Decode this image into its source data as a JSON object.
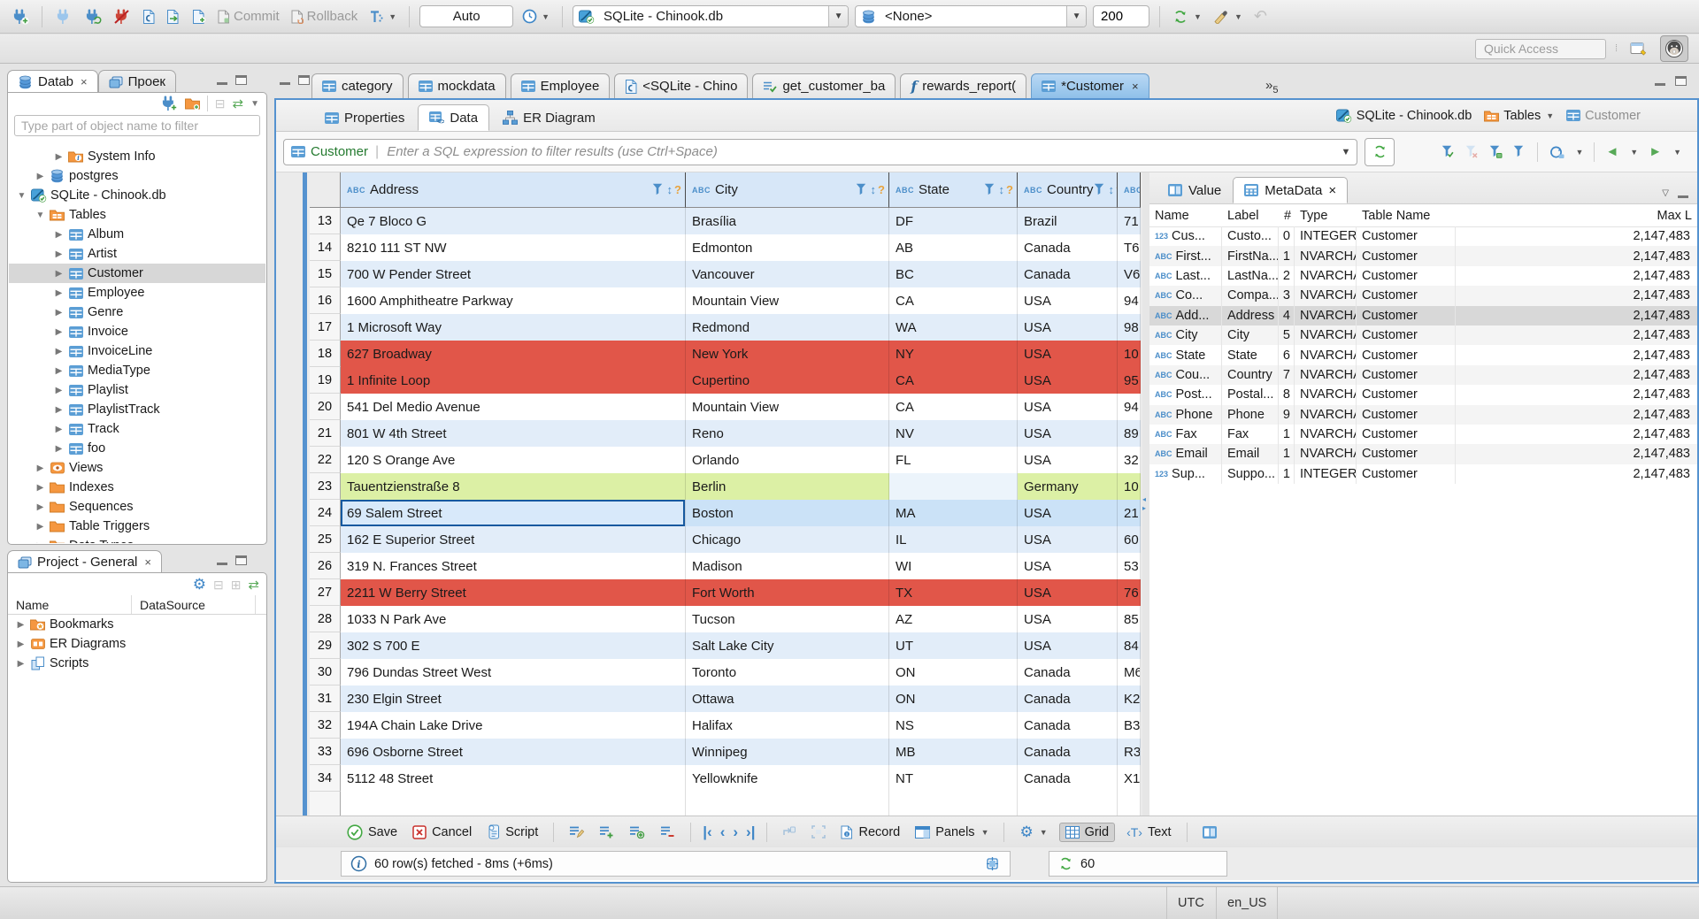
{
  "window": {
    "accent": "#3e86c7",
    "red_row": "#e15649",
    "green_row": "#dcf0a5",
    "alt_row": "#e2edf9",
    "selected_row": "#cbe2f7"
  },
  "toolbar": {
    "commit_label": "Commit",
    "rollback_label": "Rollback",
    "txn_mode": "Auto",
    "connection": "SQLite - Chinook.db",
    "schema": "<None>",
    "fetch_size": "200",
    "quick_access_placeholder": "Quick Access"
  },
  "sidebar": {
    "tabs": [
      {
        "label": "Datab"
      },
      {
        "label": "Проек"
      }
    ],
    "filter_placeholder": "Type part of object name to filter",
    "tree": [
      {
        "label": "System Info",
        "icon": "folder-info",
        "indent": 2,
        "state": "collapsed"
      },
      {
        "label": "postgres",
        "icon": "db",
        "indent": 1,
        "state": "collapsed"
      },
      {
        "label": "SQLite - Chinook.db",
        "icon": "sqlite",
        "indent": 0,
        "state": "expanded"
      },
      {
        "label": "Tables",
        "icon": "folder-table",
        "indent": 1,
        "state": "expanded"
      },
      {
        "label": "Album",
        "icon": "table",
        "indent": 2,
        "state": "collapsed"
      },
      {
        "label": "Artist",
        "icon": "table",
        "indent": 2,
        "state": "collapsed"
      },
      {
        "label": "Customer",
        "icon": "table",
        "indent": 2,
        "state": "collapsed",
        "selected": true
      },
      {
        "label": "Employee",
        "icon": "table",
        "indent": 2,
        "state": "collapsed"
      },
      {
        "label": "Genre",
        "icon": "table",
        "indent": 2,
        "state": "collapsed"
      },
      {
        "label": "Invoice",
        "icon": "table",
        "indent": 2,
        "state": "collapsed"
      },
      {
        "label": "InvoiceLine",
        "icon": "table",
        "indent": 2,
        "state": "collapsed"
      },
      {
        "label": "MediaType",
        "icon": "table",
        "indent": 2,
        "state": "collapsed"
      },
      {
        "label": "Playlist",
        "icon": "table",
        "indent": 2,
        "state": "collapsed"
      },
      {
        "label": "PlaylistTrack",
        "icon": "table",
        "indent": 2,
        "state": "collapsed"
      },
      {
        "label": "Track",
        "icon": "table",
        "indent": 2,
        "state": "collapsed"
      },
      {
        "label": "foo",
        "icon": "table",
        "indent": 2,
        "state": "collapsed"
      },
      {
        "label": "Views",
        "icon": "folder-eye",
        "indent": 1,
        "state": "collapsed"
      },
      {
        "label": "Indexes",
        "icon": "folder",
        "indent": 1,
        "state": "collapsed"
      },
      {
        "label": "Sequences",
        "icon": "folder",
        "indent": 1,
        "state": "collapsed"
      },
      {
        "label": "Table Triggers",
        "icon": "folder",
        "indent": 1,
        "state": "collapsed"
      },
      {
        "label": "Data Types",
        "icon": "folder",
        "indent": 1,
        "state": "collapsed"
      }
    ]
  },
  "project_panel": {
    "title": "Project - General",
    "columns": [
      "Name",
      "DataSource"
    ],
    "items": [
      {
        "label": "Bookmarks",
        "icon": "folder-star"
      },
      {
        "label": "ER Diagrams",
        "icon": "er-folder"
      },
      {
        "label": "Scripts",
        "icon": "scripts"
      }
    ]
  },
  "editor": {
    "tabs": [
      {
        "label": "category",
        "icon": "table"
      },
      {
        "label": "mockdata",
        "icon": "table"
      },
      {
        "label": "Employee",
        "icon": "table"
      },
      {
        "label": "<SQLite - Chino",
        "icon": "sqlpage"
      },
      {
        "label": "get_customer_ba",
        "icon": "script"
      },
      {
        "label": "rewards_report(",
        "icon": "function"
      },
      {
        "label": "*Customer",
        "icon": "table",
        "active": true,
        "closable": true
      }
    ],
    "hidden_tabs_count": "5",
    "view_tabs": [
      {
        "label": "Properties"
      },
      {
        "label": "Data"
      },
      {
        "label": "ER Diagram"
      }
    ],
    "breadcrumb": [
      {
        "label": "SQLite - Chinook.db",
        "icon": "sqlite"
      },
      {
        "label": "Tables",
        "icon": "folder-table",
        "dropdown": true
      },
      {
        "label": "Customer",
        "icon": "table",
        "muted": true
      }
    ]
  },
  "filter_bar": {
    "entity": "Customer",
    "placeholder": "Enter a SQL expression to filter results (use Ctrl+Space)"
  },
  "grid": {
    "columns": [
      "Address",
      "City",
      "State",
      "Country",
      ""
    ],
    "rows": [
      {
        "num": "13",
        "address": "Qe 7 Bloco G",
        "city": "Brasília",
        "state": "DF",
        "country": "Brazil",
        "extra": "71",
        "color": "blue"
      },
      {
        "num": "14",
        "address": "8210 111 ST NW",
        "city": "Edmonton",
        "state": "AB",
        "country": "Canada",
        "extra": "T6",
        "color": "white"
      },
      {
        "num": "15",
        "address": "700 W Pender Street",
        "city": "Vancouver",
        "state": "BC",
        "country": "Canada",
        "extra": "V6",
        "color": "blue"
      },
      {
        "num": "16",
        "address": "1600 Amphitheatre Parkway",
        "city": "Mountain View",
        "state": "CA",
        "country": "USA",
        "extra": "94",
        "color": "white"
      },
      {
        "num": "17",
        "address": "1 Microsoft Way",
        "city": "Redmond",
        "state": "WA",
        "country": "USA",
        "extra": "98",
        "color": "blue"
      },
      {
        "num": "18",
        "address": "627 Broadway",
        "city": "New York",
        "state": "NY",
        "country": "USA",
        "extra": "10",
        "color": "red"
      },
      {
        "num": "19",
        "address": "1 Infinite Loop",
        "city": "Cupertino",
        "state": "CA",
        "country": "USA",
        "extra": "95",
        "color": "red"
      },
      {
        "num": "20",
        "address": "541 Del Medio Avenue",
        "city": "Mountain View",
        "state": "CA",
        "country": "USA",
        "extra": "94",
        "color": "white"
      },
      {
        "num": "21",
        "address": "801 W 4th Street",
        "city": "Reno",
        "state": "NV",
        "country": "USA",
        "extra": "89",
        "color": "blue"
      },
      {
        "num": "22",
        "address": "120 S Orange Ave",
        "city": "Orlando",
        "state": "FL",
        "country": "USA",
        "extra": "32",
        "color": "white"
      },
      {
        "num": "23",
        "address": "Tauentzienstraße 8",
        "city": "Berlin",
        "state": "",
        "country": "Germany",
        "extra": "10",
        "color": "green",
        "state_pale": true
      },
      {
        "num": "24",
        "address": "69 Salem Street",
        "city": "Boston",
        "state": "MA",
        "country": "USA",
        "extra": "21",
        "color": "sel",
        "focus": "address"
      },
      {
        "num": "25",
        "address": "162 E Superior Street",
        "city": "Chicago",
        "state": "IL",
        "country": "USA",
        "extra": "60",
        "color": "blue"
      },
      {
        "num": "26",
        "address": "319 N. Frances Street",
        "city": "Madison",
        "state": "WI",
        "country": "USA",
        "extra": "53",
        "color": "white"
      },
      {
        "num": "27",
        "address": "2211 W Berry Street",
        "city": "Fort Worth",
        "state": "TX",
        "country": "USA",
        "extra": "76",
        "color": "red"
      },
      {
        "num": "28",
        "address": "1033 N Park Ave",
        "city": "Tucson",
        "state": "AZ",
        "country": "USA",
        "extra": "85",
        "color": "white"
      },
      {
        "num": "29",
        "address": "302 S 700 E",
        "city": "Salt Lake City",
        "state": "UT",
        "country": "USA",
        "extra": "84",
        "color": "blue"
      },
      {
        "num": "30",
        "address": "796 Dundas Street West",
        "city": "Toronto",
        "state": "ON",
        "country": "Canada",
        "extra": "M6",
        "color": "white"
      },
      {
        "num": "31",
        "address": "230 Elgin Street",
        "city": "Ottawa",
        "state": "ON",
        "country": "Canada",
        "extra": "K2",
        "color": "blue"
      },
      {
        "num": "32",
        "address": "194A Chain Lake Drive",
        "city": "Halifax",
        "state": "NS",
        "country": "Canada",
        "extra": "B3",
        "color": "white"
      },
      {
        "num": "33",
        "address": "696 Osborne Street",
        "city": "Winnipeg",
        "state": "MB",
        "country": "Canada",
        "extra": "R3",
        "color": "blue"
      },
      {
        "num": "34",
        "address": "5112 48 Street",
        "city": "Yellowknife",
        "state": "NT",
        "country": "Canada",
        "extra": "X1",
        "color": "white"
      },
      {
        "num": "",
        "address": "",
        "city": "",
        "state": "",
        "country": "",
        "extra": "",
        "color": "white",
        "clipped": true
      }
    ]
  },
  "side_panel": {
    "tabs": [
      {
        "label": "Value"
      },
      {
        "label": "MetaData",
        "closable": true,
        "active": true
      }
    ],
    "columns": [
      "Name",
      "Label",
      "#",
      "Type",
      "Table Name",
      "Max L"
    ],
    "rows": [
      {
        "prefix": "123",
        "name": "Cus...",
        "label": "Custo...",
        "num": "0",
        "type": "INTEGER",
        "table": "Customer",
        "max": "2,147,483"
      },
      {
        "prefix": "ABC",
        "name": "First...",
        "label": "FirstNa...",
        "num": "1",
        "type": "NVARCHAR",
        "table": "Customer",
        "max": "2,147,483"
      },
      {
        "prefix": "ABC",
        "name": "Last...",
        "label": "LastNa...",
        "num": "2",
        "type": "NVARCHAR",
        "table": "Customer",
        "max": "2,147,483"
      },
      {
        "prefix": "ABC",
        "name": "Co...",
        "label": "Compa...",
        "num": "3",
        "type": "NVARCHAR",
        "table": "Customer",
        "max": "2,147,483"
      },
      {
        "prefix": "ABC",
        "name": "Add...",
        "label": "Address",
        "num": "4",
        "type": "NVARCHAR",
        "table": "Customer",
        "max": "2,147,483",
        "selected": true
      },
      {
        "prefix": "ABC",
        "name": "City",
        "label": "City",
        "num": "5",
        "type": "NVARCHAR",
        "table": "Customer",
        "max": "2,147,483"
      },
      {
        "prefix": "ABC",
        "name": "State",
        "label": "State",
        "num": "6",
        "type": "NVARCHAR",
        "table": "Customer",
        "max": "2,147,483"
      },
      {
        "prefix": "ABC",
        "name": "Cou...",
        "label": "Country",
        "num": "7",
        "type": "NVARCHAR",
        "table": "Customer",
        "max": "2,147,483"
      },
      {
        "prefix": "ABC",
        "name": "Post...",
        "label": "Postal...",
        "num": "8",
        "type": "NVARCHAR",
        "table": "Customer",
        "max": "2,147,483"
      },
      {
        "prefix": "ABC",
        "name": "Phone",
        "label": "Phone",
        "num": "9",
        "type": "NVARCHAR",
        "table": "Customer",
        "max": "2,147,483"
      },
      {
        "prefix": "ABC",
        "name": "Fax",
        "label": "Fax",
        "num": "1",
        "type": "NVARCHAR",
        "table": "Customer",
        "max": "2,147,483"
      },
      {
        "prefix": "ABC",
        "name": "Email",
        "label": "Email",
        "num": "1",
        "type": "NVARCHAR",
        "table": "Customer",
        "max": "2,147,483"
      },
      {
        "prefix": "123",
        "name": "Sup...",
        "label": "Suppo...",
        "num": "1",
        "type": "INTEGER",
        "table": "Customer",
        "max": "2,147,483"
      }
    ]
  },
  "bottom_toolbar": {
    "save": "Save",
    "cancel": "Cancel",
    "script": "Script",
    "record": "Record",
    "panels": "Panels",
    "grid": "Grid",
    "text": "Text"
  },
  "status": {
    "message": "60 row(s) fetched - 8ms (+6ms)",
    "refresh_value": "60"
  },
  "status_bar": {
    "timezone": "UTC",
    "locale": "en_US"
  }
}
